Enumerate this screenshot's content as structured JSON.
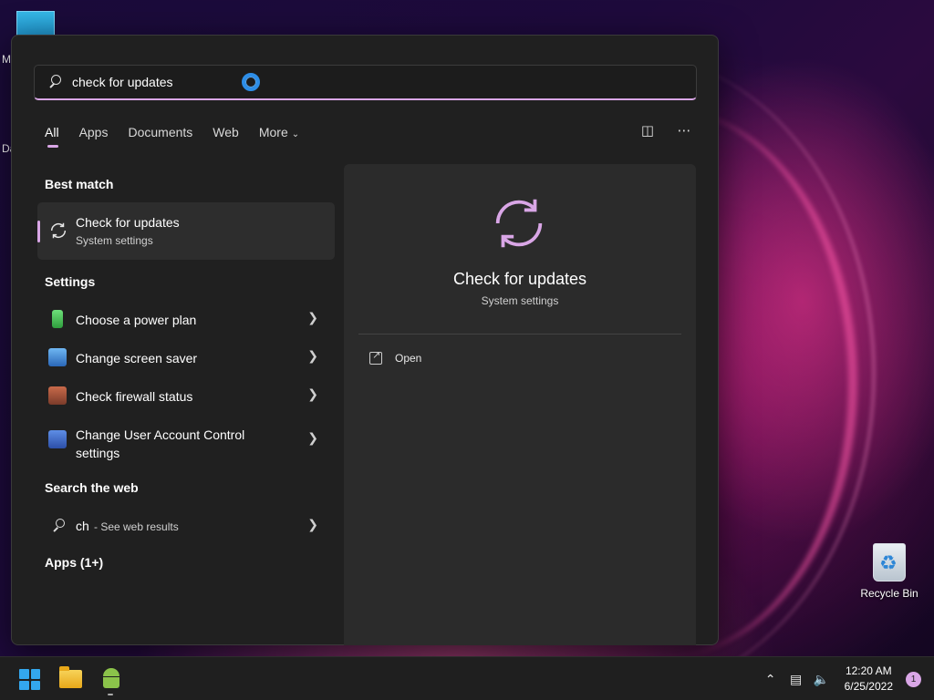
{
  "desktop": {
    "edge_labels": [
      "M",
      "Da"
    ],
    "recycle_bin_label": "Recycle Bin"
  },
  "search": {
    "query": "check for updates",
    "tabs": [
      "All",
      "Apps",
      "Documents",
      "Web",
      "More"
    ],
    "active_tab": "All"
  },
  "results": {
    "best_match_heading": "Best match",
    "best_match": {
      "title": "Check for updates",
      "subtitle": "System settings"
    },
    "settings_heading": "Settings",
    "settings": [
      {
        "label": "Choose a power plan",
        "icon": "battery-icon"
      },
      {
        "label": "Change screen saver",
        "icon": "screensaver-icon"
      },
      {
        "label": "Check firewall status",
        "icon": "firewall-icon"
      },
      {
        "label": "Change User Account Control settings",
        "icon": "uac-flag-icon"
      }
    ],
    "web_heading": "Search the web",
    "web_item": {
      "query": "ch",
      "hint": "- See web results"
    },
    "apps_heading": "Apps (1+)"
  },
  "preview": {
    "title": "Check for updates",
    "subtitle": "System settings",
    "open_label": "Open",
    "accent": "#d9a6e6"
  },
  "taskbar": {
    "time": "12:20 AM",
    "date": "6/25/2022",
    "notification_count": "1"
  }
}
